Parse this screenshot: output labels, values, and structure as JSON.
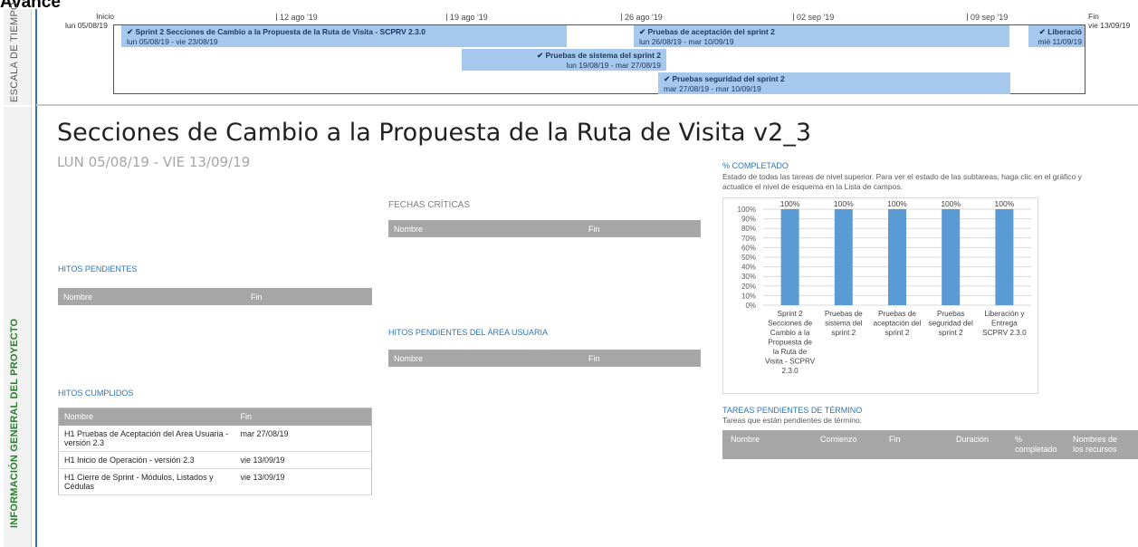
{
  "page_header": "Avance",
  "side": {
    "timeline_label": "ESCALA DE TIEMPO",
    "project_label": "INFORMACIÓN GENERAL DEL PROYECTO"
  },
  "timeline": {
    "start_label": "Inicio",
    "start_date": "lun 05/08/19",
    "end_label": "Fin",
    "end_date": "vie 13/09/19",
    "ticks": [
      "12 ago '19",
      "19 ago '19",
      "26 ago '19",
      "02 sep '19",
      "09 sep '19"
    ],
    "tasks": [
      {
        "name": "Sprint 2 Secciones de Cambio a la Propuesta de la Ruta de Visita - SCPRV 2.3.0",
        "dates": "lun 05/08/19 - vie 23/08/19"
      },
      {
        "name": "Pruebas de aceptación del sprint 2",
        "dates": "lun 26/08/19 - mar 10/09/19"
      },
      {
        "name": "Liberació",
        "dates": "mié 11/09/19"
      },
      {
        "name": "Pruebas de sistema del sprint 2",
        "dates": "lun 19/08/19 - mar 27/08/19"
      },
      {
        "name": "Pruebas seguridad del sprint 2",
        "dates": "mar 27/08/19 - mar 10/09/19"
      }
    ],
    "check": "✔"
  },
  "report": {
    "title": "Secciones de Cambio a la Propuesta de la Ruta de Visita v2_3",
    "subtitle": "LUN 05/08/19 - VIE 13/09/19"
  },
  "fechas_criticas": {
    "heading": "FECHAS CRÍTICAS",
    "col_name": "Nombre",
    "col_end": "Fin"
  },
  "hitos_pendientes": {
    "heading": "HITOS PENDIENTES",
    "col_name": "Nombre",
    "col_end": "Fin"
  },
  "hitos_usuaria": {
    "heading": "HITOS PENDIENTES DEL ÁREA USUARIA",
    "col_name": "Nombre",
    "col_end": "Fin"
  },
  "hitos_cumplidos": {
    "heading": "HITOS CUMPLIDOS",
    "col_name": "Nombre",
    "col_end": "Fin",
    "rows": [
      {
        "name": "H1 Pruebas de Aceptación del Area Usuaria - versión 2.3",
        "end": "mar 27/08/19"
      },
      {
        "name": "H1 Inicio de Operación - versión 2.3",
        "end": "vie 13/09/19"
      },
      {
        "name": "H1 Cierre de Sprint - Módulos, Listados y Cédulas",
        "end": "vie 13/09/19"
      }
    ]
  },
  "completado": {
    "heading": "% COMPLETADO",
    "desc": "Estado de todas las tareas de nivel superior. Para ver el estado de las subtareas, haga clic en el gráfico y actualice el nivel de esquema en la Lista de campos."
  },
  "tareas_pendientes": {
    "heading": "TAREAS PENDIENTES DE TÉRMINO",
    "desc": "Tareas que están pendientes de término.",
    "cols": [
      "Nombre",
      "Comienzo",
      "Fin",
      "Duración",
      "% completado",
      "Nombres de los recursos"
    ]
  },
  "chart_data": {
    "type": "bar",
    "categories": [
      "Sprint 2 Secciones de Cambio a la Propuesta de la Ruta de Visita - SCPRV 2.3.0",
      "Pruebas de sistema del sprint 2",
      "Pruebas de aceptación del sprint 2",
      "Pruebas seguridad del sprint 2",
      "Liberación y Entrega SCPRV 2.3.0"
    ],
    "category_lines": [
      [
        "Sprint 2",
        "Secciones de",
        "Cambio a la",
        "Propuesta de",
        "la Ruta de",
        "Visita - SCPRV",
        "2.3.0"
      ],
      [
        "Pruebas de",
        "sistema del",
        "sprint 2"
      ],
      [
        "Pruebas de",
        "aceptación del",
        "sprint 2"
      ],
      [
        "Pruebas",
        "seguridad del",
        "sprint 2"
      ],
      [
        "Liberación y",
        "Entrega",
        "SCPRV 2.3.0"
      ]
    ],
    "values": [
      100,
      100,
      100,
      100,
      100
    ],
    "data_labels": [
      "100%",
      "100%",
      "100%",
      "100%",
      "100%"
    ],
    "ylim": [
      0,
      100
    ],
    "yticks": [
      "0%",
      "10%",
      "20%",
      "30%",
      "40%",
      "50%",
      "60%",
      "70%",
      "80%",
      "90%",
      "100%"
    ],
    "bar_color": "#5b9bd5",
    "grid": true
  }
}
